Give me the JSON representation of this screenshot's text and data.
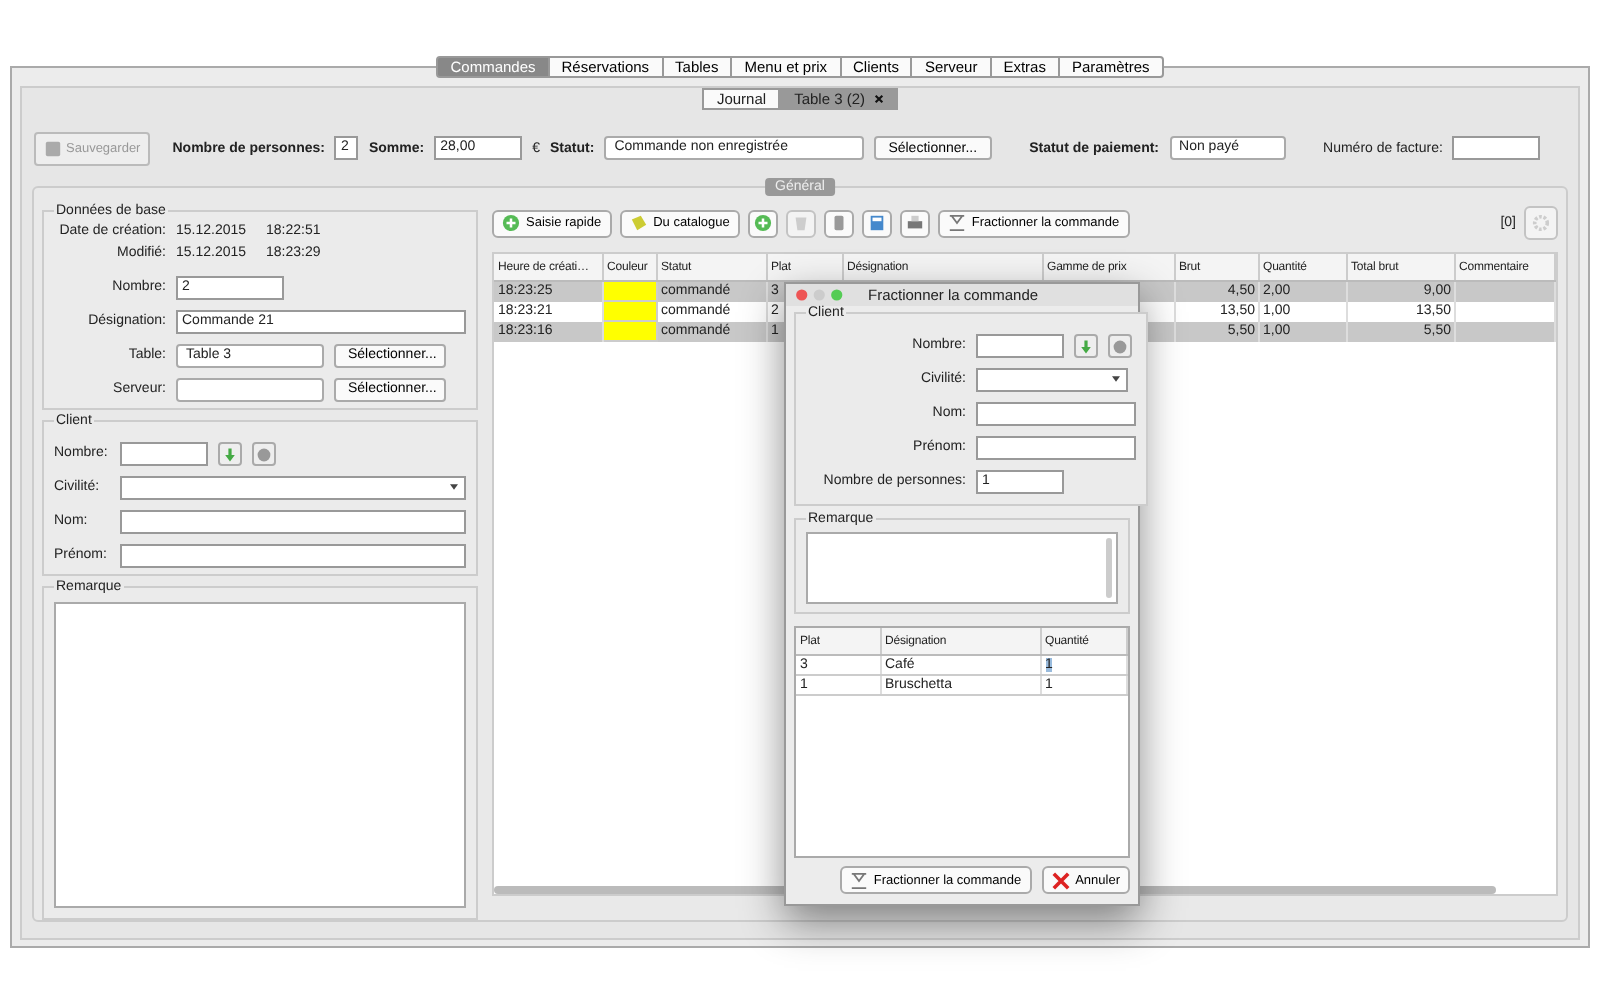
{
  "top_tabs": [
    {
      "label": "Commandes",
      "selected": true
    },
    {
      "label": "Réservations",
      "selected": false
    },
    {
      "label": "Tables",
      "selected": false
    },
    {
      "label": "Menu et prix",
      "selected": false
    },
    {
      "label": "Clients",
      "selected": false
    },
    {
      "label": "Serveur",
      "selected": false
    },
    {
      "label": "Extras",
      "selected": false
    },
    {
      "label": "Paramètres",
      "selected": false
    }
  ],
  "sub_tabs": [
    {
      "label": "Journal",
      "selected": false,
      "closable": false
    },
    {
      "label": "Table 3 (2)",
      "selected": true,
      "closable": true
    }
  ],
  "toolbar": {
    "save_button": {
      "label": "Sauvegarder",
      "disabled": true
    },
    "persons_label": "Nombre de personnes:",
    "persons_value": "2",
    "sum_label": "Somme:",
    "sum_value": "28,00",
    "currency": "€",
    "status_label": "Statut:",
    "status_value": "Commande non enregistrée",
    "select_button": "Sélectionner...",
    "payment_label": "Statut de paiement:",
    "payment_value": "Non payé",
    "invoice_label": "Numéro de facture:"
  },
  "general_label": "Général",
  "base_data": {
    "title": "Données de base",
    "created_label": "Date de création:",
    "created_date": "15.12.2015",
    "created_time": "18:22:51",
    "modified_label": "Modifié:",
    "modified_date": "15.12.2015",
    "modified_time": "18:23:29",
    "number_label": "Nombre:",
    "number_value": "2",
    "designation_label": "Désignation:",
    "designation_value": "Commande 21",
    "table_label": "Table:",
    "table_value": "Table 3",
    "table_button": "Sélectionner...",
    "server_label": "Serveur:",
    "server_button": "Sélectionner..."
  },
  "client": {
    "title": "Client",
    "number_label": "Nombre:",
    "civility_label": "Civilité:",
    "name_label": "Nom:",
    "firstname_label": "Prénom:"
  },
  "remark": {
    "title": "Remarque"
  },
  "order_toolbar": {
    "quick_entry": "Saisie rapide",
    "catalogue": "Du catalogue",
    "split": "Fractionner la commande",
    "counter": "[0]"
  },
  "table": {
    "columns": [
      "Heure de créati…",
      "Couleur",
      "Statut",
      "Plat",
      "Désignation",
      "Gamme de prix",
      "Brut",
      "Quantité",
      "Total brut",
      "Commentaire"
    ],
    "rows": [
      {
        "time": "18:23:25",
        "color": "#ffff00",
        "status": "commandé",
        "plat": "3",
        "brut": "4,50",
        "quantity": "2,00",
        "total": "9,00",
        "selected": true
      },
      {
        "time": "18:23:21",
        "color": "#ffff00",
        "status": "commandé",
        "plat": "2",
        "brut": "13,50",
        "quantity": "1,00",
        "total": "13,50",
        "selected": false
      },
      {
        "time": "18:23:16",
        "color": "#ffff00",
        "status": "commandé",
        "plat": "1",
        "brut": "5,50",
        "quantity": "1,00",
        "total": "5,50",
        "selected": true
      }
    ]
  },
  "dialog": {
    "title": "Fractionner la commande",
    "client_title": "Client",
    "number_label": "Nombre:",
    "civility_label": "Civilité:",
    "name_label": "Nom:",
    "firstname_label": "Prénom:",
    "persons_label": "Nombre de personnes:",
    "persons_value": "1",
    "remark_title": "Remarque",
    "columns": [
      "Plat",
      "Désignation",
      "Quantité"
    ],
    "rows": [
      {
        "plat": "3",
        "designation": "Café",
        "quantity": "1",
        "editing": true
      },
      {
        "plat": "1",
        "designation": "Bruschetta",
        "quantity": "1",
        "editing": false
      }
    ],
    "split_button": "Fractionner la commande",
    "cancel_button": "Annuler"
  }
}
